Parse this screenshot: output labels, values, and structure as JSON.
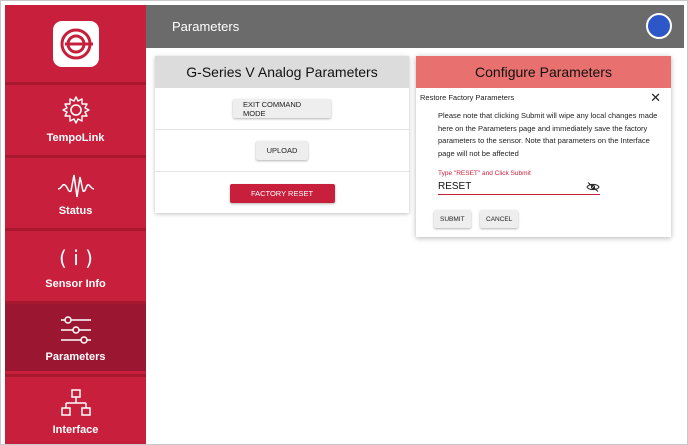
{
  "topbar": {
    "title": "Parameters"
  },
  "sidebar": {
    "items": [
      {
        "label": "TempoLink",
        "icon": "gear-icon"
      },
      {
        "label": "Status",
        "icon": "pulse-icon"
      },
      {
        "label": "Sensor Info",
        "icon": "info-icon"
      },
      {
        "label": "Parameters",
        "icon": "sliders-icon"
      },
      {
        "label": "Interface",
        "icon": "network-icon"
      }
    ]
  },
  "analog_card": {
    "title": "G-Series V Analog Parameters",
    "exit_label": "EXIT COMMAND MODE",
    "upload_label": "UPLOAD",
    "reset_label": "FACTORY RESET"
  },
  "configure_card": {
    "title": "Configure Parameters",
    "subtitle": "Restore Factory Parameters",
    "close_glyph": "✕",
    "note": "Please note that clicking Submit will wipe any local changes made here on the Parameters page and immediately save the factory parameters to the sensor. Note that parameters on the Interface page will not be affected",
    "field_label": "Type \"RESET\" and Click Submit",
    "field_value": "RESET",
    "submit_label": "SUBMIT",
    "cancel_label": "CANCEL"
  },
  "colors": {
    "brand": "#c8203c",
    "active": "#9b1631",
    "topbar": "#6b6b6b",
    "header_accent": "#e8706f",
    "avatar": "#2d56c9"
  }
}
